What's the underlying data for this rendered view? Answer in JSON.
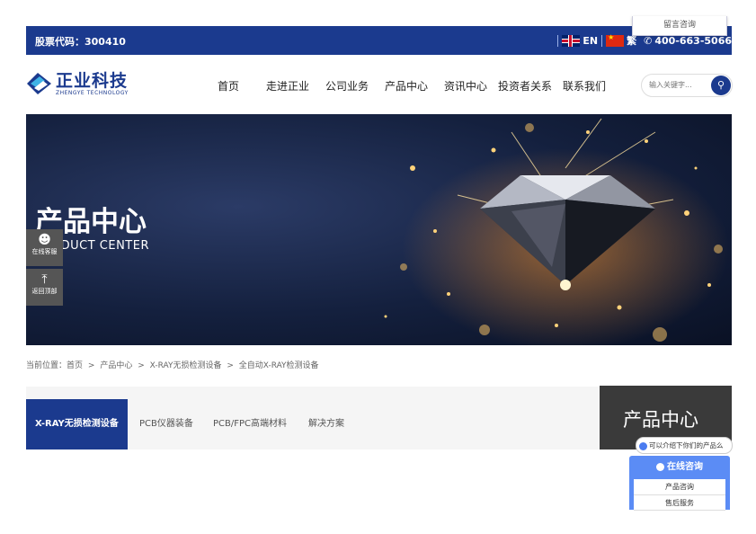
{
  "topbar": {
    "stock_code": "股票代码：300410",
    "lang_en": "EN",
    "lang_cn": "繁",
    "phone_icon": "phone-icon",
    "phone": "400-663-5066",
    "popup_label": "留言咨询"
  },
  "logo": {
    "cn": "正业科技",
    "en": "ZHENGYE TECHNOLOGY"
  },
  "nav": {
    "items": [
      "首页",
      "走进正业",
      "公司业务",
      "产品中心",
      "资讯中心",
      "投资者关系",
      "联系我们"
    ]
  },
  "search": {
    "placeholder": "输入关键字...",
    "icon": "search-icon"
  },
  "banner": {
    "title": "产品中心",
    "subtitle": "PRODUCT CENTER"
  },
  "sidebar": {
    "online_label": "在线客服",
    "online_icon": "chat-icon",
    "top_label": "返回顶部",
    "top_icon": "arrow-up-icon"
  },
  "breadcrumb": {
    "prefix": "当前位置：",
    "items": [
      "首页",
      "产品中心",
      "X-RAY无损检测设备",
      "全自动X-RAY检测设备"
    ],
    "separator": ">"
  },
  "tabs": {
    "items": [
      "X-RAY无损检测设备",
      "PCB仪器装备",
      "PCB/FPC高端材料",
      "解决方案"
    ],
    "active": 0
  },
  "product_box": {
    "title": "产品中心"
  },
  "chat": {
    "bubble_text": "可以介绍下你们的产品么",
    "header": "在线咨询",
    "items": [
      "产品咨询",
      "售后服务"
    ]
  },
  "colors": {
    "brand": "#1b3a8e",
    "consult": "#5b8cf5"
  }
}
